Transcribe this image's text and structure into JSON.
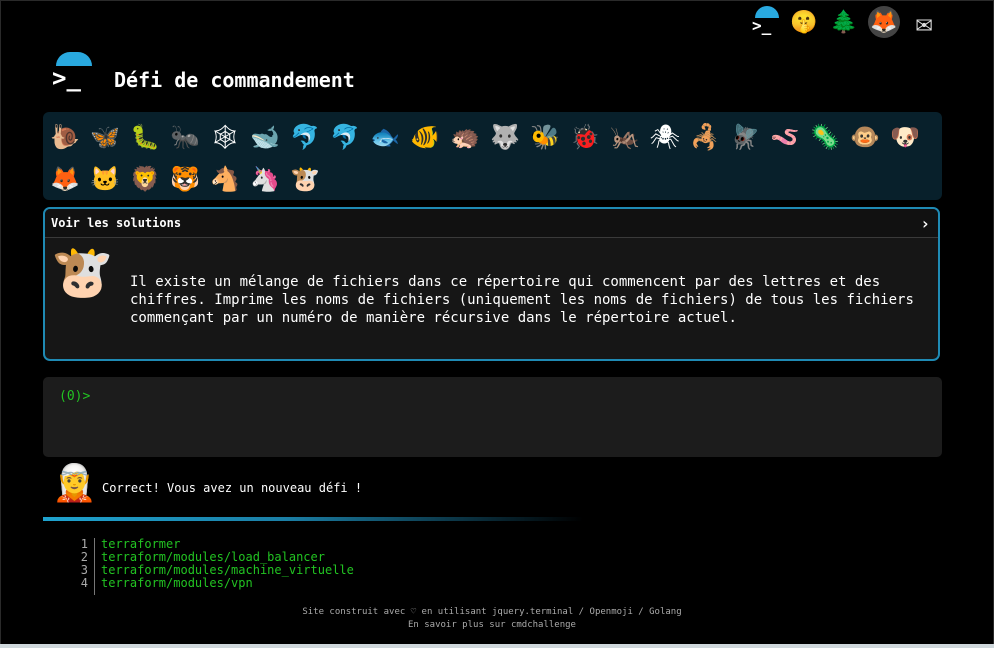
{
  "header": {
    "title": "Défi de commandement",
    "top_icons": [
      {
        "name": "terminal-icon",
        "glyph": ">_"
      },
      {
        "name": "shushing-face-icon",
        "glyph": "🤫"
      },
      {
        "name": "evergreen-tree-icon",
        "glyph": "🌲"
      },
      {
        "name": "gitlab-icon",
        "glyph": "🦊"
      },
      {
        "name": "envelope-icon",
        "glyph": "✉"
      }
    ]
  },
  "animals": [
    {
      "name": "snail-icon",
      "glyph": "🐌"
    },
    {
      "name": "butterfly-icon",
      "glyph": "🦋"
    },
    {
      "name": "caterpillar-icon",
      "glyph": "🐛"
    },
    {
      "name": "ant-icon",
      "glyph": "🐜"
    },
    {
      "name": "spider-web-icon",
      "glyph": "🕸"
    },
    {
      "name": "whale-icon",
      "glyph": "🐋"
    },
    {
      "name": "dolphin-icon",
      "glyph": "🐬"
    },
    {
      "name": "dolphin-2-icon",
      "glyph": "🐬"
    },
    {
      "name": "fish-icon",
      "glyph": "🐟"
    },
    {
      "name": "tropical-fish-icon",
      "glyph": "🐠"
    },
    {
      "name": "hedgehog-icon",
      "glyph": "🦔"
    },
    {
      "name": "wolf-icon",
      "glyph": "🐺"
    },
    {
      "name": "bee-icon",
      "glyph": "🐝"
    },
    {
      "name": "ladybug-icon",
      "glyph": "🐞"
    },
    {
      "name": "cricket-icon",
      "glyph": "🦗"
    },
    {
      "name": "spider-icon",
      "glyph": "🕷"
    },
    {
      "name": "scorpion-icon",
      "glyph": "🦂"
    },
    {
      "name": "fly-icon",
      "glyph": "🪰"
    },
    {
      "name": "worm-icon",
      "glyph": "🪱"
    },
    {
      "name": "microbe-icon",
      "glyph": "🦠"
    },
    {
      "name": "monkey-icon",
      "glyph": "🐵"
    },
    {
      "name": "dog-icon",
      "glyph": "🐶"
    },
    {
      "name": "fox-icon",
      "glyph": "🦊"
    },
    {
      "name": "cat-icon",
      "glyph": "🐱"
    },
    {
      "name": "lion-icon",
      "glyph": "🦁"
    },
    {
      "name": "tiger-icon",
      "glyph": "🐯"
    },
    {
      "name": "horse-icon",
      "glyph": "🐴"
    },
    {
      "name": "unicorn-icon",
      "glyph": "🦄"
    },
    {
      "name": "cow-icon",
      "glyph": "🐮"
    }
  ],
  "solutions": {
    "label": "Voir les solutions",
    "chevron": "›",
    "mascot": "🐮",
    "challenge_text": "Il existe un mélange de fichiers dans ce répertoire qui commencent par des lettres et des chiffres. Imprime les noms de fichiers (uniquement les noms de fichiers) de tous les fichiers commençant par un numéro de manière récursive dans le répertoire actuel."
  },
  "terminal": {
    "prompt": "(0)>"
  },
  "result": {
    "mascot": "🧝",
    "message": "Correct! Vous avez un nouveau défi !"
  },
  "output": {
    "lines": [
      {
        "num": "1",
        "text": "terraformer"
      },
      {
        "num": "2",
        "text": "terraform/modules/load_balancer"
      },
      {
        "num": "3",
        "text": "terraform/modules/machine_virtuelle"
      },
      {
        "num": "4",
        "text": "terraform/modules/vpn"
      }
    ]
  },
  "footer": {
    "line1": "Site construit avec ♡ en utilisant jquery.terminal / Openmoji / Golang",
    "line2": "En savoir plus sur cmdchallenge"
  },
  "colors": {
    "accent": "#29a9df",
    "prompt_green": "#22c322",
    "panel_dark": "#08202b"
  }
}
